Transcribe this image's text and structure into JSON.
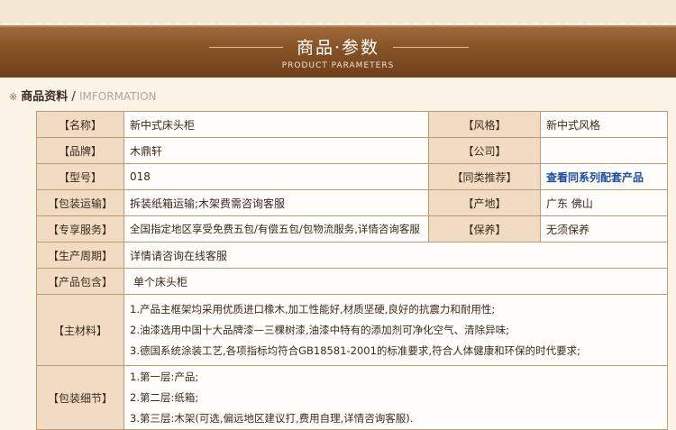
{
  "banner": {
    "title": "商品·参数",
    "subtitle": "PRODUCT PARAMETERS"
  },
  "section": {
    "mark": "※",
    "title_cn": "商品资料",
    "separator": "/",
    "title_en": "IMFORMATION"
  },
  "rows": {
    "name": {
      "label": "【名称】",
      "value": "新中式床头柜"
    },
    "style": {
      "label": "【风格】",
      "value": "新中式风格"
    },
    "brand": {
      "label": "【品牌】",
      "value": "木鼎轩"
    },
    "company": {
      "label": "【公司】",
      "value": ""
    },
    "model": {
      "label": "【型号】",
      "value": "018"
    },
    "similar": {
      "label": "【同类推荐】",
      "value": "查看同系列配套产品"
    },
    "shipping": {
      "label": "【包装运输】",
      "value": "拆装纸箱运输;木架费需咨询客服"
    },
    "origin": {
      "label": "【产地】",
      "value": "广东 佛山"
    },
    "service": {
      "label": "【专享服务】",
      "value": "全国指定地区享受免费五包/有偿五包/包物流服务,详情咨询客服"
    },
    "warranty": {
      "label": "【保养】",
      "value": "无须保养"
    },
    "cycle": {
      "label": "【生产周期】",
      "value": "详情请咨询在线客服"
    },
    "contents": {
      "label": "【产品包含】",
      "value": "单个床头柜"
    },
    "material": {
      "label": "【主材料】",
      "lines": [
        "1.产品主框架均采用优质进口橡木,加工性能好,材质坚硬,良好的抗震力和耐用性;",
        "2.油漆选用中国十大品牌漆—三棵树漆,油漆中特有的添加剂可净化空气、清除异味;",
        "3.德国系统涂装工艺,各项指标均符合GB18581-2001的标准要求,符合人体健康和环保的时代要求;"
      ]
    },
    "packing": {
      "label": "【包装细节】",
      "lines": [
        "1.第一层:产品;",
        "2.第二层:纸箱;",
        "3.第三层:木架(可选,偏远地区建议打,费用自理,详情咨询客服)."
      ]
    }
  },
  "colors": {
    "banner": "#7b4a22",
    "label_bg": "#f1dcc3",
    "border": "#b99a79",
    "link": "#1c4fa0"
  }
}
